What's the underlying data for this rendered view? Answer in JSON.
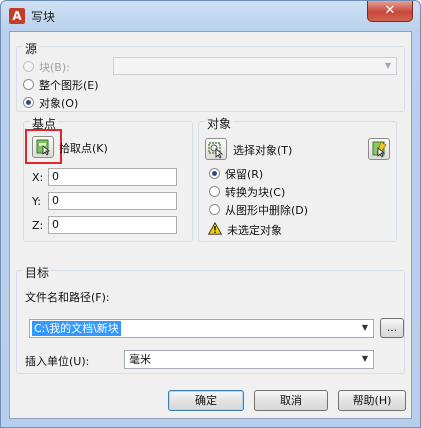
{
  "window": {
    "title": "写块",
    "close_glyph": "✕"
  },
  "source": {
    "title": "源",
    "options": [
      {
        "label": "块(B):",
        "state": "disabled"
      },
      {
        "label": "整个图形(E)",
        "state": "unchecked"
      },
      {
        "label": "对象(O)",
        "state": "checked"
      }
    ],
    "block_combo_value": ""
  },
  "base_point": {
    "title": "基点",
    "pick_label": "拾取点(K)",
    "x_label": "X:",
    "x_value": "0",
    "y_label": "Y:",
    "y_value": "0",
    "z_label": "Z:",
    "z_value": "0"
  },
  "objects": {
    "title": "对象",
    "select_label": "选择对象(T)",
    "options": [
      {
        "label": "保留(R)",
        "state": "checked"
      },
      {
        "label": "转换为块(C)",
        "state": "unchecked"
      },
      {
        "label": "从图形中删除(D)",
        "state": "unchecked"
      }
    ],
    "warning": "未选定对象"
  },
  "destination": {
    "title": "目标",
    "file_label": "文件名和路径(F):",
    "file_value": "C:\\我的文档\\新块",
    "browse_label": "...",
    "units_label": "插入单位(U):",
    "units_value": "毫米"
  },
  "buttons": {
    "ok": "确定",
    "cancel": "取消",
    "help": "帮助(H)"
  },
  "icons": {
    "app": "autocad-a-icon",
    "pick_point": "pick-point-icon",
    "select_objects": "select-objects-icon",
    "quick_select": "quick-select-icon",
    "warning": "warning-icon"
  },
  "colors": {
    "highlight": "#e0262c",
    "selection": "#3399ff"
  }
}
